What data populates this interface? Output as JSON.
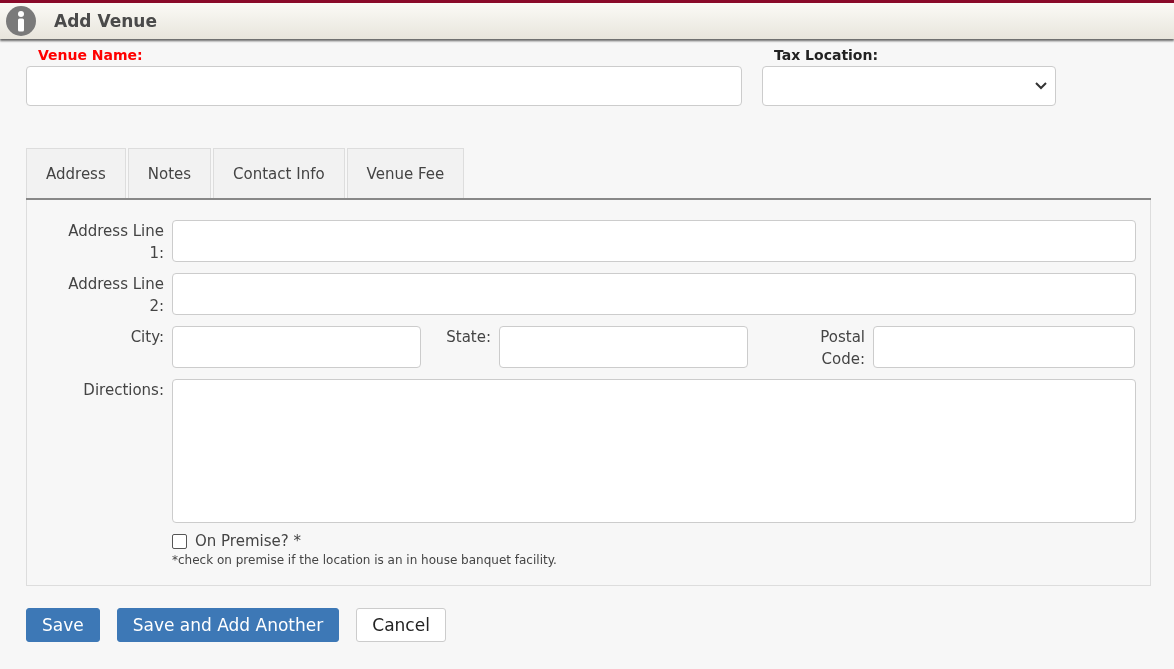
{
  "header": {
    "title": "Add Venue"
  },
  "top_fields": [
    {
      "label": "Venue Name:",
      "required": true,
      "kind": "text"
    },
    {
      "label": "Tax Location:",
      "required": false,
      "kind": "select"
    }
  ],
  "tabs": [
    {
      "label": "Address"
    },
    {
      "label": "Notes"
    },
    {
      "label": "Contact Info"
    },
    {
      "label": "Venue Fee"
    }
  ],
  "address_rows": [
    {
      "fields": [
        {
          "label": "Address Line 1:",
          "kind": "text"
        }
      ]
    },
    {
      "fields": [
        {
          "label": "Address Line 2:",
          "kind": "text"
        }
      ]
    },
    {
      "fields": [
        {
          "label": "City:",
          "kind": "text"
        },
        {
          "label": "State:",
          "kind": "text"
        },
        {
          "label": "Postal Code:",
          "kind": "text"
        }
      ]
    },
    {
      "fields": [
        {
          "label": "Directions:",
          "kind": "textarea"
        }
      ]
    }
  ],
  "on_premise": {
    "label": "On Premise? *",
    "checked": false,
    "note": "*check on premise if the location is an in house banquet facility."
  },
  "buttons": [
    {
      "label": "Save",
      "kind": "primary"
    },
    {
      "label": "Save and Add Another",
      "kind": "primary"
    },
    {
      "label": "Cancel",
      "kind": "default"
    }
  ]
}
